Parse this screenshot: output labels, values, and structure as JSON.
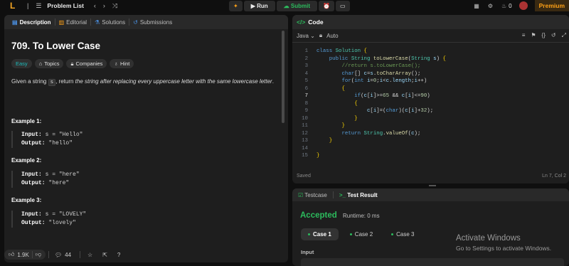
{
  "topbar": {
    "logo": "L",
    "problem_list": "Problem List",
    "run": "Run",
    "submit": "Submit",
    "streak": "0",
    "premium": "Premium"
  },
  "left_tabs": {
    "description": "Description",
    "editorial": "Editorial",
    "solutions": "Solutions",
    "submissions": "Submissions"
  },
  "problem": {
    "title": "709. To Lower Case",
    "tags": {
      "easy": "Easy",
      "topics": "Topics",
      "companies": "Companies",
      "hint": "Hint"
    },
    "desc_1": "Given a string ",
    "desc_code": "s",
    "desc_2": ", return ",
    "desc_italic": "the string after replacing every uppercase letter with the same lowercase letter",
    "desc_3": "."
  },
  "examples": [
    {
      "title": "Example 1:",
      "input_label": "Input:",
      "input": " s = \"Hello\"",
      "output_label": "Output:",
      "output": " \"hello\""
    },
    {
      "title": "Example 2:",
      "input_label": "Input:",
      "input": " s = \"here\"",
      "output_label": "Output:",
      "output": " \"here\""
    },
    {
      "title": "Example 3:",
      "input_label": "Input:",
      "input": " s = \"LOVELY\"",
      "output_label": "Output:",
      "output": " \"lovely\""
    }
  ],
  "footer": {
    "likes": "1.9K",
    "comments": "44"
  },
  "code_panel": {
    "title": "Code",
    "language": "Java",
    "auto": "Auto",
    "status": "Saved",
    "cursor": "Ln 7, Col 2"
  },
  "code_lines": [
    "1",
    "2",
    "3",
    "4",
    "5",
    "6",
    "7",
    "8",
    "9",
    "10",
    "11",
    "12",
    "13",
    "14",
    "15"
  ],
  "result_panel": {
    "testcase_tab": "Testcase",
    "result_tab": "Test Result",
    "verdict": "Accepted",
    "runtime": "Runtime: 0 ms",
    "cases": [
      "Case 1",
      "Case 2",
      "Case 3"
    ],
    "input_label": "Input"
  },
  "watermark": {
    "line1": "Activate Windows",
    "line2": "Go to Settings to activate Windows."
  },
  "colors": {
    "accepted": "#2cbb5d",
    "premium": "#ffa116",
    "easy": "#1cbaba"
  }
}
